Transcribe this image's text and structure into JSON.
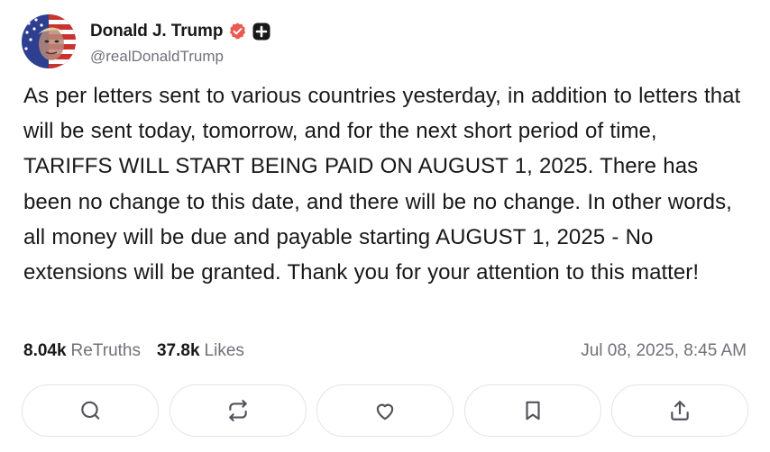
{
  "author": {
    "display_name": "Donald J. Trump",
    "handle": "@realDonaldTrump",
    "avatar_icon": "avatar-flag-portrait",
    "verified_icon": "verified-badge-icon",
    "verified_color": "#ea5a4f",
    "plus_icon": "truth-plus-icon"
  },
  "post": {
    "text": "As per letters sent to various countries yesterday, in addition to letters that will be sent today, tomorrow, and for the next short period of time, TARIFFS WILL START BEING PAID ON AUGUST 1, 2025. There has been no change to this date, and there will be no change. In other words, all money will be due and payable starting AUGUST 1, 2025 - No extensions will be granted. Thank you for your attention to this matter!"
  },
  "stats": {
    "retruths_count": "8.04k",
    "retruths_label": "ReTruths",
    "likes_count": "37.8k",
    "likes_label": "Likes",
    "timestamp": "Jul 08, 2025, 8:45 AM"
  },
  "actions": [
    {
      "icon": "reply-icon"
    },
    {
      "icon": "retruth-icon"
    },
    {
      "icon": "like-icon"
    },
    {
      "icon": "bookmark-icon"
    },
    {
      "icon": "share-icon"
    }
  ],
  "colors": {
    "text": "#18181b",
    "muted": "#71717a",
    "border": "#e4e4e7",
    "icon": "#52525b"
  }
}
